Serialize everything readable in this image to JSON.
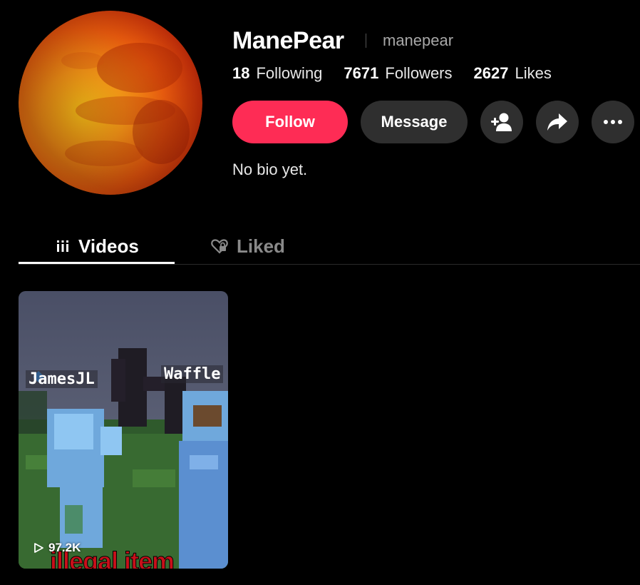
{
  "profile": {
    "display_name": "ManePear",
    "handle": "manepear",
    "bio": "No bio yet.",
    "avatar_icon": "planet-mars-avatar"
  },
  "stats": {
    "following_count": "18",
    "following_label": "Following",
    "followers_count": "7671",
    "followers_label": "Followers",
    "likes_count": "2627",
    "likes_label": "Likes"
  },
  "actions": {
    "follow_label": "Follow",
    "message_label": "Message",
    "add_friend_icon": "add-user-icon",
    "share_icon": "share-arrow-icon",
    "more_icon": "more-dots-icon"
  },
  "tabs": [
    {
      "label": "Videos",
      "icon": "grid-bars-icon",
      "active": true
    },
    {
      "label": "Liked",
      "icon": "heart-lock-icon",
      "active": false
    }
  ],
  "videos": [
    {
      "views": "97.2K",
      "caption_overlay": "illegal item",
      "nametags": [
        "JamesJL",
        "Waffle"
      ]
    }
  ],
  "colors": {
    "follow_accent": "#fe2c55",
    "button_dark": "#2f2f2f",
    "background": "#000000"
  }
}
